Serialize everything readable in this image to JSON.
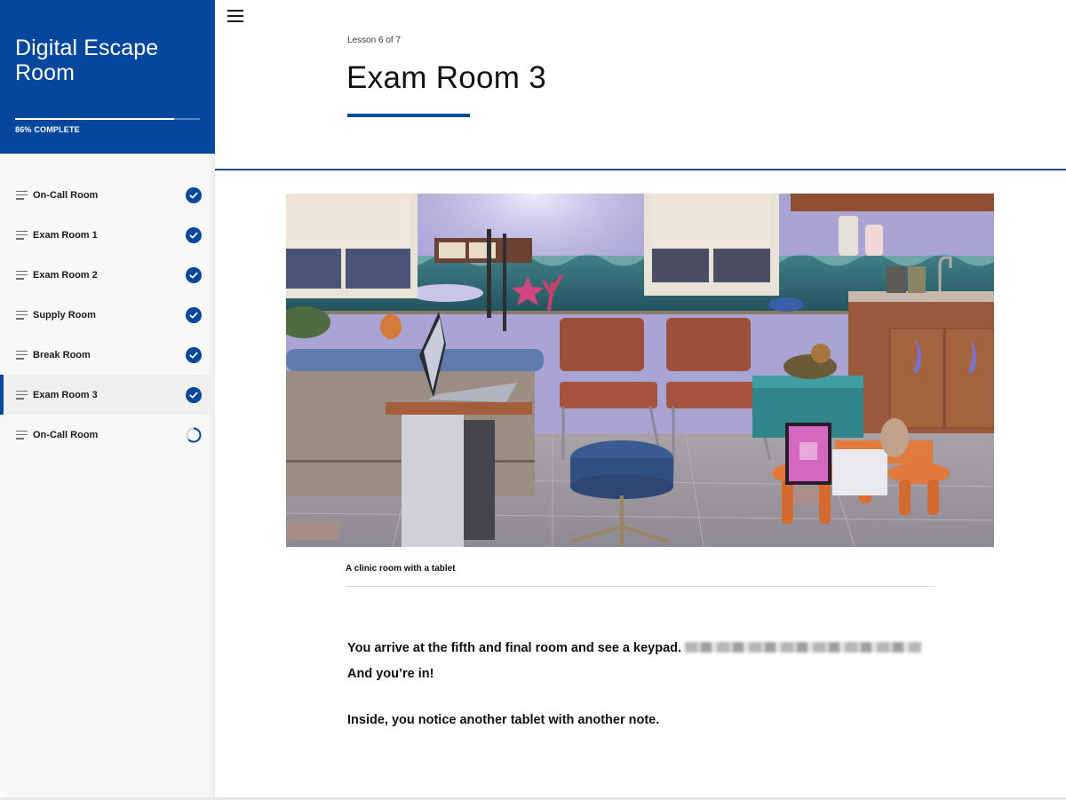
{
  "colors": {
    "brand": "#04479c",
    "sidebar_bg": "#f8f8f9",
    "active_row_bg": "#efeff0",
    "divider": "#1f4f86"
  },
  "sidebar": {
    "course_title": "Digital Escape Room",
    "progress_percent": 86,
    "progress_label": "86% COMPLETE",
    "lessons": [
      {
        "label": "On-Call Room",
        "status": "complete",
        "status_icon": "check-circle-icon",
        "active": false
      },
      {
        "label": "Exam Room 1",
        "status": "complete",
        "status_icon": "check-circle-icon",
        "active": false
      },
      {
        "label": "Exam Room 2",
        "status": "complete",
        "status_icon": "check-circle-icon",
        "active": false
      },
      {
        "label": "Supply Room",
        "status": "complete",
        "status_icon": "check-circle-icon",
        "active": false
      },
      {
        "label": "Break Room",
        "status": "complete",
        "status_icon": "check-circle-icon",
        "active": false
      },
      {
        "label": "Exam Room 3",
        "status": "complete",
        "status_icon": "check-circle-icon",
        "active": true
      },
      {
        "label": "On-Call Room",
        "status": "in-progress",
        "status_icon": "progress-ring-icon",
        "active": false
      }
    ]
  },
  "main": {
    "menu_icon": "hamburger-menu-icon",
    "lesson_counter": "Lesson 6 of 7",
    "lesson_title": "Exam Room 3",
    "image": {
      "alt": "A clinic room with a tablet",
      "caption": "A clinic room with a tablet"
    },
    "paragraph1_text": "You arrive at the fifth and final room and see a keypad.",
    "paragraph1_redacted": "[blurred text]",
    "paragraph1_tail": "And you’re in!",
    "paragraph2_text": "Inside, you notice another tablet with another note."
  }
}
